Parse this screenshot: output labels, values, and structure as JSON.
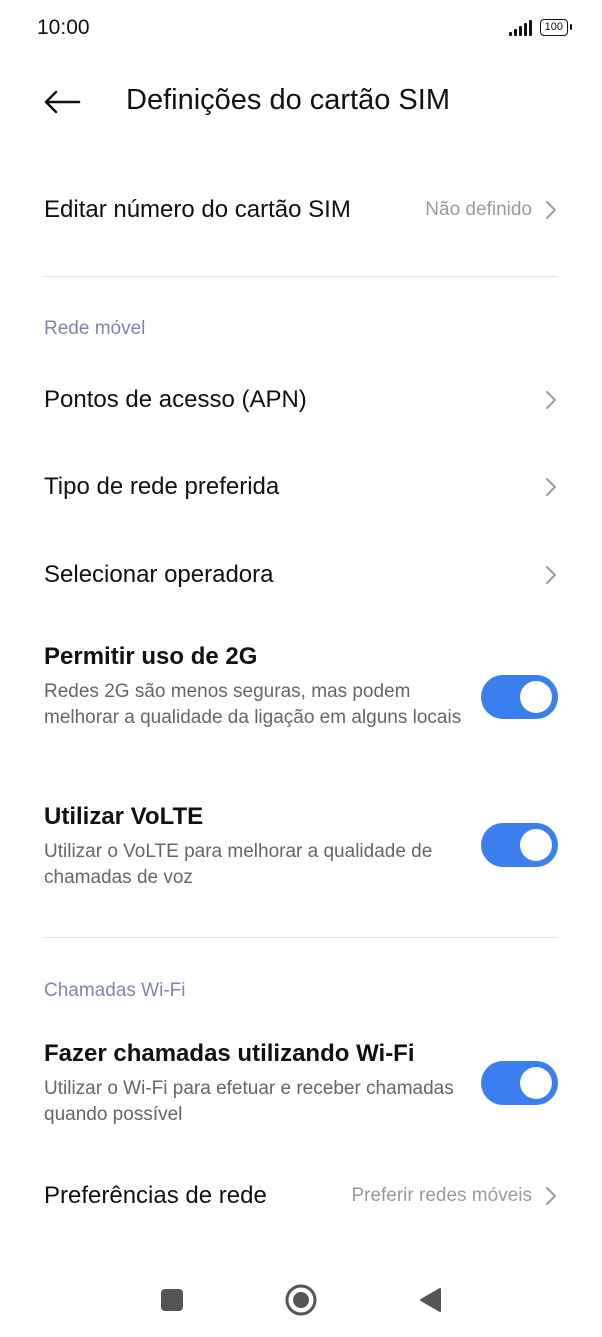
{
  "status_bar": {
    "time": "10:00",
    "battery": "100"
  },
  "header": {
    "title": "Definições do cartão SIM"
  },
  "sim_number": {
    "label": "Editar número do cartão SIM",
    "value": "Não definido"
  },
  "mobile_network": {
    "section_label": "Rede móvel",
    "apn_label": "Pontos de acesso (APN)",
    "network_type_label": "Tipo de rede preferida",
    "operator_label": "Selecionar operadora",
    "allow_2g": {
      "title": "Permitir uso de 2G",
      "subtitle": "Redes 2G são menos seguras, mas podem melhorar a qualidade da ligação em alguns locais",
      "enabled": true
    },
    "volte": {
      "title": "Utilizar VoLTE",
      "subtitle": "Utilizar o VoLTE para melhorar a qualidade de chamadas de voz",
      "enabled": true
    }
  },
  "wifi_calling": {
    "section_label": "Chamadas Wi-Fi",
    "calls_over_wifi": {
      "title": "Fazer chamadas utilizando Wi-Fi",
      "subtitle": "Utilizar o Wi-Fi para efetuar e receber chamadas quando possível",
      "enabled": true
    },
    "network_preferences": {
      "label": "Preferências de rede",
      "value": "Preferir redes móveis"
    }
  },
  "colors": {
    "accent": "#3b7fee",
    "section_label": "#7b86ad",
    "secondary_text": "#9a9a9a"
  },
  "navbar": {
    "icons": [
      "recents-square-icon",
      "home-circle-icon",
      "back-triangle-icon"
    ]
  }
}
